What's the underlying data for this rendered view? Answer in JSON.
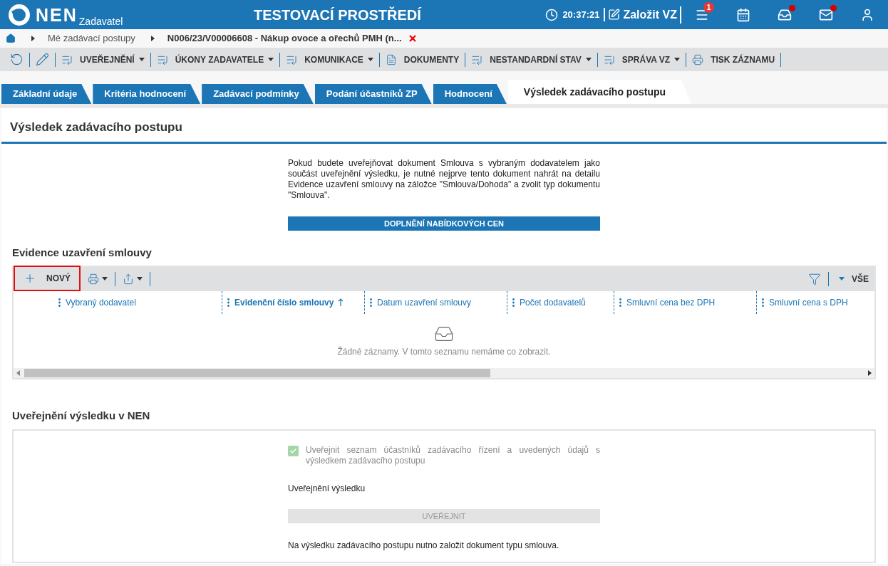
{
  "header": {
    "logo_text": "NEN",
    "logo_subtitle": "Zadavatel",
    "environment": "TESTOVACÍ PROSTŘEDÍ",
    "time": "20:37:21",
    "create_button": "Založit VZ",
    "icons": [
      {
        "kind": "menu",
        "badge": "1",
        "alert": false
      },
      {
        "kind": "calendar",
        "alert": false
      },
      {
        "kind": "inbox",
        "alert": true
      },
      {
        "kind": "mail",
        "alert": true
      },
      {
        "kind": "user",
        "alert": false
      }
    ]
  },
  "breadcrumb": {
    "items": [
      "Mé zadávací postupy",
      "N006/23/V00006608 - Nákup ovoce a ořechů PMH (n..."
    ]
  },
  "toolbar": [
    {
      "kind": "refresh"
    },
    {
      "kind": "edit"
    },
    {
      "kind": "list",
      "label": "UVEŘEJNĚNÍ",
      "dropdown": true
    },
    {
      "kind": "list",
      "label": "ÚKONY ZADAVATELE",
      "dropdown": true
    },
    {
      "kind": "list",
      "label": "KOMUNIKACE",
      "dropdown": true
    },
    {
      "kind": "document",
      "label": "DOKUMENTY",
      "dropdown": false
    },
    {
      "kind": "list",
      "label": "NESTANDARDNÍ STAV",
      "dropdown": true
    },
    {
      "kind": "list",
      "label": "SPRÁVA VZ",
      "dropdown": true
    },
    {
      "kind": "print",
      "label": "TISK ZÁZNAMU",
      "dropdown": false
    }
  ],
  "tabs": [
    {
      "label": "Základní údaje",
      "selected": false
    },
    {
      "label": "Kritéria hodnocení",
      "selected": false
    },
    {
      "label": "Zadávací podmínky",
      "selected": false
    },
    {
      "label": "Podání účastníků ZP",
      "selected": false
    },
    {
      "label": "Hodnocení",
      "selected": false
    },
    {
      "label": "Výsledek zadávacího postupu",
      "selected": true
    }
  ],
  "page_title": "Výsledek zadávacího postupu",
  "info_text": "Pokud budete uveřejňovat dokument Smlouva s vybraným dodavatelem jako součást uveřejnění výsledku, je nutné nejprve tento dokument nahrát na detailu Evidence uzavření smlouvy na záložce \"Smlouva/Dohoda\" a zvolit typ dokumentu \"Smlouva\".",
  "supplement_button": "DOPLNĚNÍ NABÍDKOVÝCH CEN",
  "contracts": {
    "title": "Evidence uzavření smlouvy",
    "new_button": {
      "label": "NOVÝ",
      "highlighted": true
    },
    "view_filter": "VŠE",
    "columns": [
      {
        "label": "Vybraný dodavatel",
        "sorted": false
      },
      {
        "label": "Evidenční číslo smlouvy",
        "sorted": true
      },
      {
        "label": "Datum uzavření smlouvy",
        "sorted": false
      },
      {
        "label": "Počet dodavatelů",
        "sorted": false
      },
      {
        "label": "Smluvní cena bez DPH",
        "sorted": false
      },
      {
        "label": "Smluvní cena s DPH",
        "sorted": false
      }
    ],
    "empty_message": "Žádné záznamy. V tomto seznamu nemáme co zobrazit."
  },
  "publication": {
    "title": "Uveřejnění výsledku v NEN",
    "checkbox": {
      "label": "Uveřejnit seznam účastníků zadávacího řízení a uvedených údajů s výsledkem zadávacího postupu",
      "checked": true,
      "disabled": true
    },
    "subtitle": "Uveřejnění výsledku",
    "publish_button": {
      "label": "UVEŘEJNIT",
      "disabled": true
    },
    "note": "Na výsledku zadávacího postupu nutno založit dokument typu smlouva."
  }
}
